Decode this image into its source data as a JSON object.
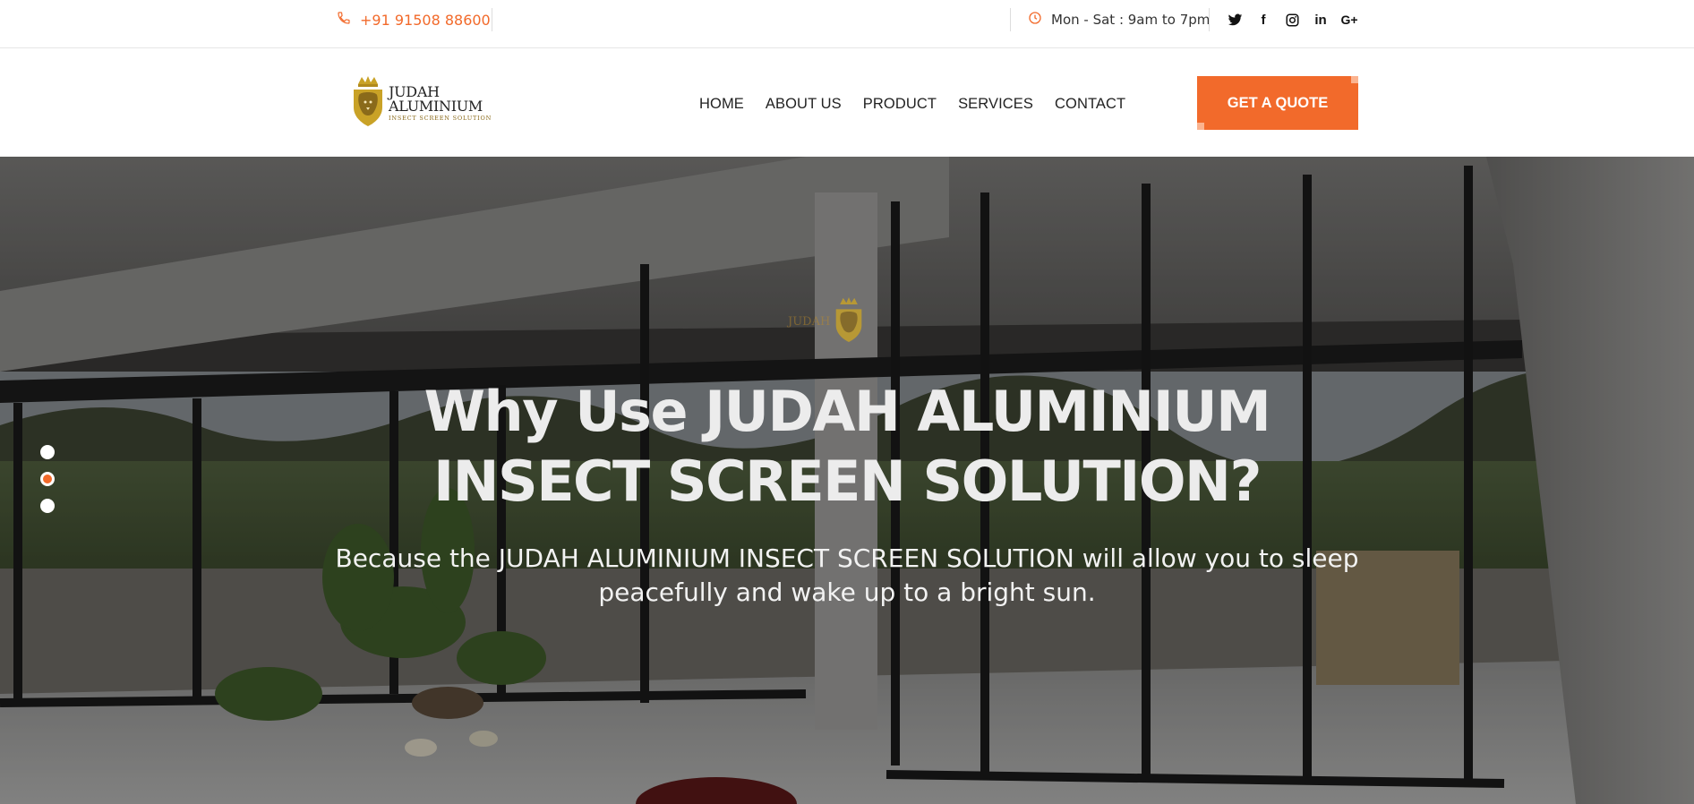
{
  "topbar": {
    "phone": "+91 91508 88600",
    "phone_icon": "phone-icon",
    "hours": "Mon - Sat : 9am to 7pm",
    "hours_icon": "clock-icon",
    "socials": [
      {
        "icon": "twitter-icon",
        "glyph": "𝕏"
      },
      {
        "icon": "facebook-icon",
        "glyph": "f"
      },
      {
        "icon": "instagram-icon",
        "glyph": "◎"
      },
      {
        "icon": "linkedin-icon",
        "glyph": "in"
      },
      {
        "icon": "google-plus-icon",
        "glyph": "G+"
      }
    ]
  },
  "header": {
    "logo_name": "JUDAH ALUMINIUM",
    "logo_tagline": "INSECT SCREEN SOLUTION",
    "nav": [
      "HOME",
      "ABOUT US",
      "PRODUCT",
      "SERVICES",
      "CONTACT"
    ],
    "cta": "GET A QUOTE"
  },
  "hero": {
    "title": "Why Use JUDAH ALUMINIUM INSECT SCREEN SOLUTION?",
    "subtitle": "Because the JUDAH ALUMINIUM INSECT SCREEN SOLUTION will allow you to sleep peacefully and wake up to a bright sun.",
    "watermark": "JUDAH",
    "slides": 3,
    "active_slide": 2
  },
  "colors": {
    "accent": "#f26a2b",
    "gold": "#c9a227"
  }
}
